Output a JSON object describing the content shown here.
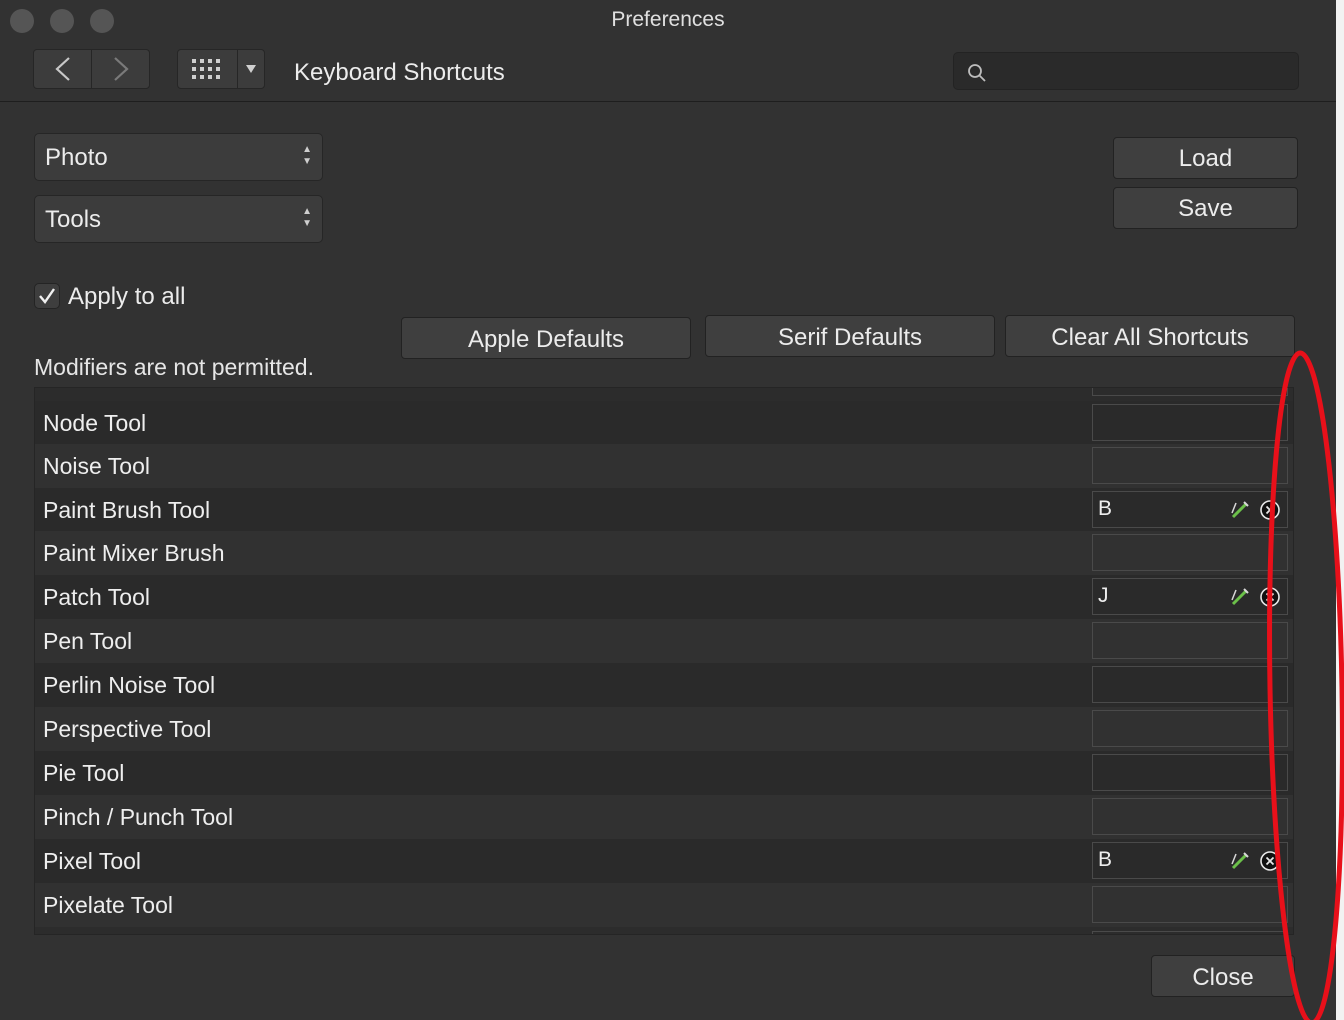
{
  "window": {
    "title": "Preferences"
  },
  "toolbar": {
    "title": "Keyboard Shortcuts",
    "back_glyph": "<",
    "forward_glyph": ">",
    "search_placeholder": ""
  },
  "selectors": {
    "app_value": "Photo",
    "category_value": "Tools"
  },
  "buttons": {
    "load": "Load",
    "save": "Save",
    "apple_defaults": "Apple Defaults",
    "serif_defaults": "Serif Defaults",
    "clear_all": "Clear All Shortcuts",
    "close": "Close"
  },
  "apply_to_all": {
    "label": "Apply to all",
    "checked": true
  },
  "note": "Modifiers are not permitted.",
  "shortcuts": [
    {
      "name": "Node Tool",
      "key": ""
    },
    {
      "name": "Noise Tool",
      "key": ""
    },
    {
      "name": "Paint Brush Tool",
      "key": "B"
    },
    {
      "name": "Paint Mixer Brush",
      "key": ""
    },
    {
      "name": "Patch Tool",
      "key": "J"
    },
    {
      "name": "Pen Tool",
      "key": ""
    },
    {
      "name": "Perlin Noise Tool",
      "key": ""
    },
    {
      "name": "Perspective Tool",
      "key": ""
    },
    {
      "name": "Pie Tool",
      "key": ""
    },
    {
      "name": "Pinch / Punch Tool",
      "key": ""
    },
    {
      "name": "Pixel Tool",
      "key": "B"
    },
    {
      "name": "Pixelate Tool",
      "key": ""
    }
  ],
  "icons": {
    "edit": "pencil-icon",
    "clear": "clear-circle-icon",
    "search": "search-icon",
    "grid": "grid-icon"
  },
  "colors": {
    "annotation": "#e8101a",
    "edit_icon": "#6cc04a"
  }
}
